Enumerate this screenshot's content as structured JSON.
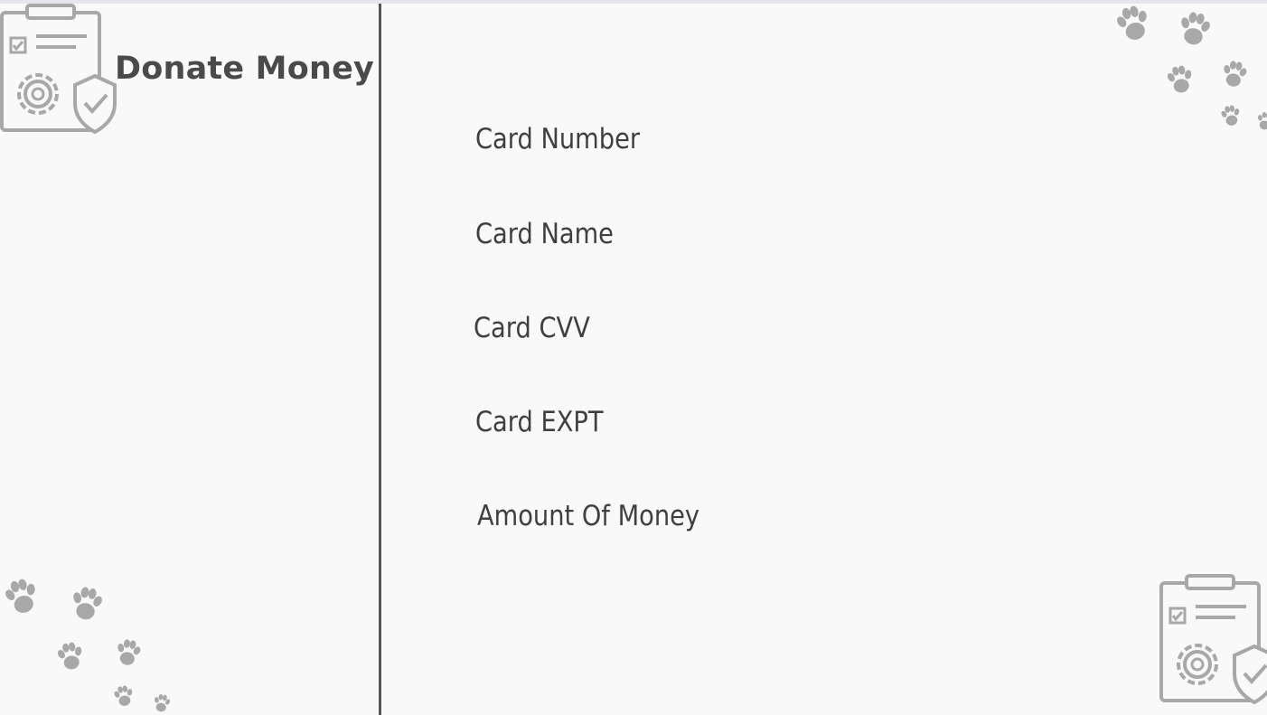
{
  "page": {
    "title": "Donate Money"
  },
  "form": {
    "labels": {
      "card_number": "Card Number",
      "card_name": "Card Name",
      "card_cvv": "Card CVV",
      "card_expt": "Card EXPT",
      "amount": "Amount Of Money"
    }
  },
  "decorations": {
    "icons": [
      "clipboard-settings-icon",
      "paw-prints-icon"
    ],
    "icon_color": "#a8a8a8",
    "divider_color": "#555555",
    "text_color": "#4a4a4a"
  }
}
